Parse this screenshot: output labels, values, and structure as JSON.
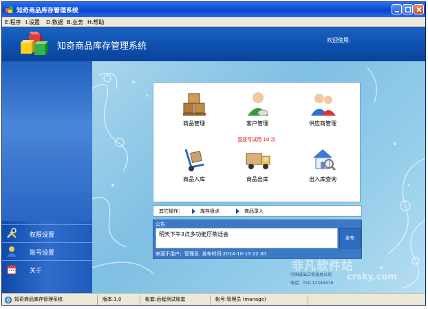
{
  "window": {
    "title": "知奇商品库存管理系统"
  },
  "menu": [
    "E.程序",
    "I.设置",
    "D.数据",
    "B.业务",
    "H.帮助"
  ],
  "banner": {
    "app_title": "知奇商品库存管理系统",
    "welcome": "欢迎使用."
  },
  "sidebar": {
    "items": [
      {
        "label": "权限设置",
        "icon": "tools-icon"
      },
      {
        "label": "账号设置",
        "icon": "user-icon"
      },
      {
        "label": "关于",
        "icon": "calendar-icon"
      }
    ]
  },
  "tiles": [
    {
      "label": "商品管理",
      "icon": "boxes-icon"
    },
    {
      "label": "客户管理",
      "icon": "customer-icon"
    },
    {
      "label": "供应商管理",
      "icon": "supplier-icon"
    },
    {
      "label": "商品入库",
      "icon": "handtruck-icon"
    },
    {
      "label": "商品出库",
      "icon": "truck-icon"
    },
    {
      "label": "出入库查询",
      "icon": "house-search-icon"
    }
  ],
  "trial_notice": "您还可试用 10 次",
  "other_ops": {
    "label": "其它操作：",
    "links": [
      "库存盘点",
      "商品录入"
    ]
  },
  "notice": {
    "header": "公告",
    "content": "明天下午3点多功能厅茶话会",
    "send_label": "发布",
    "footer": "来源于用户：管理员.  发布时间:2014-10-13 22:30"
  },
  "company": {
    "name": "中国进出口贸易总公司",
    "phone": "电话：010-12345678"
  },
  "watermark": {
    "line1": "非凡软件站",
    "line2": "crsky.com"
  },
  "status": {
    "app_name": "知奇商品库存管理系统",
    "version": "版本:1.0",
    "account_set": "帐套:远程测试账套",
    "account": "帐号:管理员 (manage)"
  },
  "colors": {
    "titlebar": "#0b4fd8",
    "banner": "#0e4fae",
    "sidebar": "#2f6dcc",
    "main_bg": "#7fbfe3",
    "trial_text": "#e00000"
  }
}
